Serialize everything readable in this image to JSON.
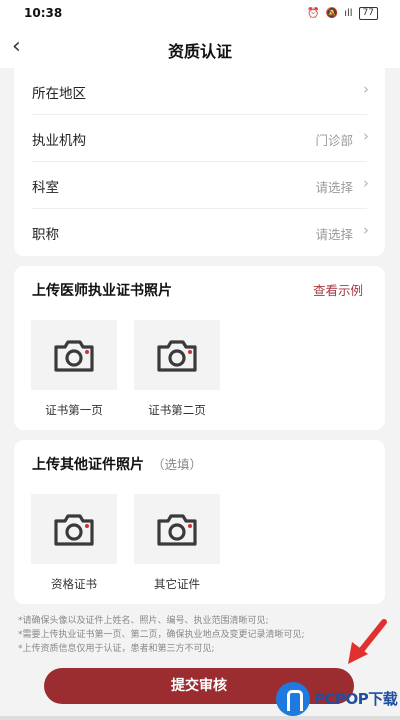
{
  "status": {
    "time": "10:38",
    "signal": "ıll",
    "battery": "77"
  },
  "header": {
    "back_icon": "‹",
    "title": "资质认证"
  },
  "form": {
    "rows": [
      {
        "label": "所在地区",
        "value": ""
      },
      {
        "label": "执业机构",
        "value": "门诊部"
      },
      {
        "label": "科室",
        "value": "请选择"
      },
      {
        "label": "职称",
        "value": "请选择"
      }
    ]
  },
  "license_section": {
    "title": "上传医师执业证书照片",
    "example_link": "查看示例",
    "slots": [
      {
        "caption": "证书第一页"
      },
      {
        "caption": "证书第二页"
      }
    ]
  },
  "other_section": {
    "title": "上传其他证件照片",
    "optional": "（选填）",
    "slots": [
      {
        "caption": "资格证书"
      },
      {
        "caption": "其它证件"
      }
    ]
  },
  "notes": [
    "*请确保头像以及证件上姓名、照片、编号、执业范围清晰可见;",
    "*需要上传执业证书第一页、第二页，确保执业地点及变更记录清晰可见;",
    "*上传资质信息仅用于认证，患者和第三方不可见;"
  ],
  "submit_label": "提交审核",
  "watermark": "PCPOP下载",
  "colors": {
    "accent": "#9b2d31",
    "link": "#a33a3f",
    "background": "#f3f3f3"
  },
  "icons": {
    "camera": "camera-icon",
    "chevron": "chevron-right-icon",
    "arrow": "red-arrow-icon"
  }
}
